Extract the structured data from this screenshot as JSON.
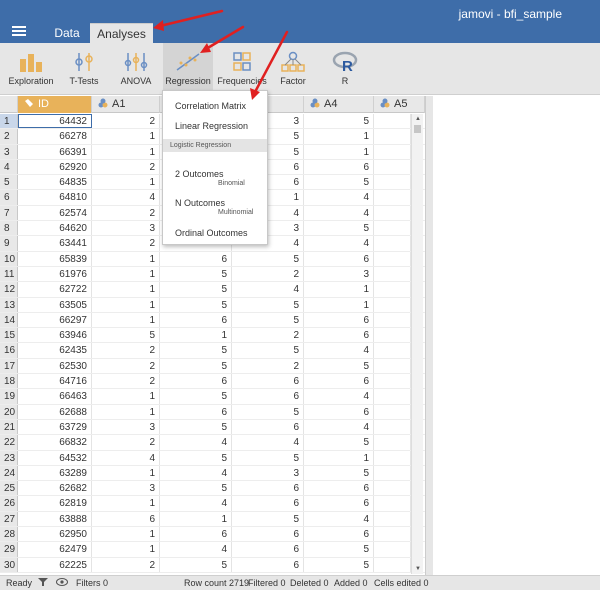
{
  "window": {
    "title": "jamovi - bfi_sample"
  },
  "tabs": [
    {
      "label": "Data"
    },
    {
      "label": "Analyses"
    }
  ],
  "ribbon": {
    "buttons": [
      {
        "label": "Exploration",
        "icon": "exploration-icon"
      },
      {
        "label": "T-Tests",
        "icon": "ttests-icon"
      },
      {
        "label": "ANOVA",
        "icon": "anova-icon"
      },
      {
        "label": "Regression",
        "icon": "regression-icon"
      },
      {
        "label": "Frequencies",
        "icon": "frequencies-icon"
      },
      {
        "label": "Factor",
        "icon": "factor-icon"
      },
      {
        "label": "R",
        "icon": "r-icon"
      }
    ]
  },
  "grid": {
    "columns": [
      {
        "name": "ID",
        "icon": "id-icon"
      },
      {
        "name": "A1",
        "icon": "ordinal-icon"
      },
      {
        "name": "A4",
        "icon": "ordinal-icon"
      },
      {
        "name": "A5",
        "icon": "ordinal-icon"
      }
    ],
    "rows": [
      {
        "n": "1",
        "id": "64432",
        "a1": "2",
        "a2": "",
        "a3": "3",
        "a4": "5",
        "a5": ""
      },
      {
        "n": "2",
        "id": "66278",
        "a1": "1",
        "a2": "",
        "a3": "5",
        "a4": "1",
        "a5": ""
      },
      {
        "n": "3",
        "id": "66391",
        "a1": "1",
        "a2": "",
        "a3": "5",
        "a4": "1",
        "a5": ""
      },
      {
        "n": "4",
        "id": "62920",
        "a1": "2",
        "a2": "",
        "a3": "6",
        "a4": "6",
        "a5": ""
      },
      {
        "n": "5",
        "id": "64835",
        "a1": "1",
        "a2": "",
        "a3": "6",
        "a4": "5",
        "a5": ""
      },
      {
        "n": "6",
        "id": "64810",
        "a1": "4",
        "a2": "",
        "a3": "1",
        "a4": "4",
        "a5": ""
      },
      {
        "n": "7",
        "id": "62574",
        "a1": "2",
        "a2": "",
        "a3": "4",
        "a4": "4",
        "a5": ""
      },
      {
        "n": "8",
        "id": "64620",
        "a1": "3",
        "a2": "",
        "a3": "3",
        "a4": "5",
        "a5": ""
      },
      {
        "n": "9",
        "id": "63441",
        "a1": "2",
        "a2": "",
        "a3": "4",
        "a4": "4",
        "a5": ""
      },
      {
        "n": "10",
        "id": "65839",
        "a1": "1",
        "a2": "6",
        "a3": "5",
        "a4": "6",
        "a5": ""
      },
      {
        "n": "11",
        "id": "61976",
        "a1": "1",
        "a2": "5",
        "a3": "2",
        "a4": "3",
        "a5": ""
      },
      {
        "n": "12",
        "id": "62722",
        "a1": "1",
        "a2": "5",
        "a3": "4",
        "a4": "1",
        "a5": ""
      },
      {
        "n": "13",
        "id": "63505",
        "a1": "1",
        "a2": "5",
        "a3": "5",
        "a4": "1",
        "a5": ""
      },
      {
        "n": "14",
        "id": "66297",
        "a1": "1",
        "a2": "6",
        "a3": "5",
        "a4": "6",
        "a5": ""
      },
      {
        "n": "15",
        "id": "63946",
        "a1": "5",
        "a2": "1",
        "a3": "2",
        "a4": "6",
        "a5": ""
      },
      {
        "n": "16",
        "id": "62435",
        "a1": "2",
        "a2": "5",
        "a3": "5",
        "a4": "4",
        "a5": ""
      },
      {
        "n": "17",
        "id": "62530",
        "a1": "2",
        "a2": "5",
        "a3": "2",
        "a4": "5",
        "a5": ""
      },
      {
        "n": "18",
        "id": "64716",
        "a1": "2",
        "a2": "6",
        "a3": "6",
        "a4": "6",
        "a5": ""
      },
      {
        "n": "19",
        "id": "66463",
        "a1": "1",
        "a2": "5",
        "a3": "6",
        "a4": "4",
        "a5": ""
      },
      {
        "n": "20",
        "id": "62688",
        "a1": "1",
        "a2": "6",
        "a3": "5",
        "a4": "6",
        "a5": ""
      },
      {
        "n": "21",
        "id": "63729",
        "a1": "3",
        "a2": "5",
        "a3": "6",
        "a4": "4",
        "a5": ""
      },
      {
        "n": "22",
        "id": "66832",
        "a1": "2",
        "a2": "4",
        "a3": "4",
        "a4": "5",
        "a5": ""
      },
      {
        "n": "23",
        "id": "64532",
        "a1": "4",
        "a2": "5",
        "a3": "5",
        "a4": "1",
        "a5": ""
      },
      {
        "n": "24",
        "id": "63289",
        "a1": "1",
        "a2": "4",
        "a3": "3",
        "a4": "5",
        "a5": ""
      },
      {
        "n": "25",
        "id": "62682",
        "a1": "3",
        "a2": "5",
        "a3": "6",
        "a4": "6",
        "a5": ""
      },
      {
        "n": "26",
        "id": "62819",
        "a1": "1",
        "a2": "4",
        "a3": "6",
        "a4": "6",
        "a5": ""
      },
      {
        "n": "27",
        "id": "63888",
        "a1": "6",
        "a2": "1",
        "a3": "5",
        "a4": "4",
        "a5": ""
      },
      {
        "n": "28",
        "id": "62950",
        "a1": "1",
        "a2": "6",
        "a3": "6",
        "a4": "6",
        "a5": ""
      },
      {
        "n": "29",
        "id": "62479",
        "a1": "1",
        "a2": "4",
        "a3": "6",
        "a4": "5",
        "a5": ""
      },
      {
        "n": "30",
        "id": "62225",
        "a1": "2",
        "a2": "5",
        "a3": "6",
        "a4": "5",
        "a5": ""
      }
    ]
  },
  "menu": {
    "items": [
      {
        "label": "Correlation Matrix",
        "sub": ""
      },
      {
        "label": "Linear Regression",
        "sub": ""
      },
      {
        "label": "2 Outcomes",
        "sub": "Binomial"
      },
      {
        "label": "N Outcomes",
        "sub": "Multinomial"
      },
      {
        "label": "Ordinal Outcomes",
        "sub": ""
      }
    ],
    "section": "Logistic Regression"
  },
  "status": {
    "ready": "Ready",
    "filters": "Filters 0",
    "row_count": "Row count 2719",
    "filtered": "Filtered 0",
    "deleted": "Deleted 0",
    "added": "Added 0",
    "cells_edited": "Cells edited 0"
  },
  "colors": {
    "titlebar": "#3e6da9",
    "annotation": "#e02020",
    "id_column": "#e8b25a"
  }
}
